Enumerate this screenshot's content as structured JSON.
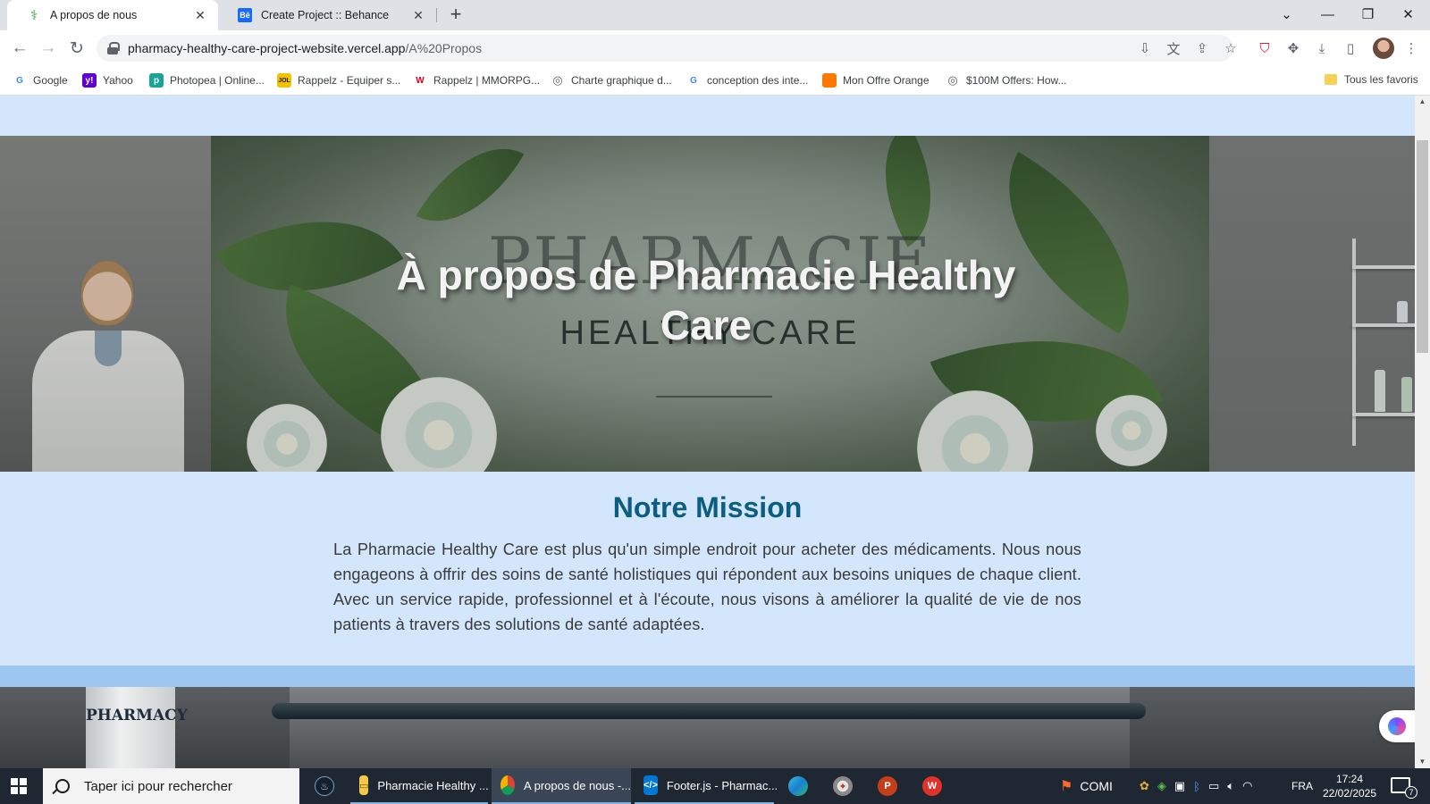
{
  "browser": {
    "tabs": [
      {
        "title": "A propos de nous",
        "active": true,
        "favicon": "caduceus-icon"
      },
      {
        "title": "Create Project :: Behance",
        "active": false,
        "favicon": "behance-icon",
        "favicon_text": "Bē"
      }
    ],
    "new_tab_label": "+",
    "window_controls": {
      "tab_search": "⌄",
      "minimize": "—",
      "restore": "❐",
      "close": "✕"
    },
    "url_host": "pharmacy-healthy-care-project-website.vercel.app",
    "url_path": "/A%20Propos",
    "bookmarks": [
      {
        "label": "Google",
        "icon": "google-icon",
        "icon_text": "G",
        "color": "#4285f4"
      },
      {
        "label": "Yahoo",
        "icon": "yahoo-icon",
        "icon_text": "y!",
        "color": "#6001d2"
      },
      {
        "label": "Photopea | Online...",
        "icon": "photopea-icon",
        "icon_text": "p",
        "color": "#18a497"
      },
      {
        "label": "Rappelz - Equiper s...",
        "icon": "rappelz-icon",
        "icon_text": "JOL",
        "color": "#1a1a1a"
      },
      {
        "label": "Rappelz | MMORPG...",
        "icon": "webzen-icon",
        "icon_text": "W",
        "color": "#d9001b"
      },
      {
        "label": "Charte graphique d...",
        "icon": "globe-icon",
        "icon_text": "◎",
        "color": "#5f6368"
      },
      {
        "label": "conception des inte...",
        "icon": "google-icon",
        "icon_text": "G",
        "color": "#4285f4"
      },
      {
        "label": "Mon Offre Orange",
        "icon": "orange-icon",
        "icon_text": "",
        "color": "#ff7900"
      },
      {
        "label": "$100M Offers: How...",
        "icon": "globe-icon",
        "icon_text": "◎",
        "color": "#5f6368"
      }
    ],
    "all_bookmarks_label": "Tous les favoris"
  },
  "hero": {
    "title": "À propos de Pharmacie Healthy Care",
    "background_brand_top": "PHARMACIE",
    "background_brand_bottom": "HEALTHY CARE"
  },
  "mission": {
    "title": "Notre Mission",
    "text": "La Pharmacie Healthy Care est plus qu'un simple endroit pour acheter des médicaments. Nous nous engageons à offrir des soins de santé holistiques qui répondent aux besoins uniques de chaque client. Avec un service rapide, professionnel et à l'écoute, nous visons à améliorer la qualité de vie de nos patients à travers des solutions de santé adaptées."
  },
  "next_section": {
    "jar_label": "PHARMACY"
  },
  "taskbar": {
    "search_placeholder": "Taper ici pour rechercher",
    "tasks": [
      {
        "label": "",
        "icon": "steam-icon"
      },
      {
        "label": "Pharmacie Healthy ...",
        "icon": "file-explorer-icon"
      },
      {
        "label": "A propos de nous -...",
        "icon": "chrome-icon"
      },
      {
        "label": "Footer.js - Pharmac...",
        "icon": "vscode-icon"
      },
      {
        "label": "",
        "icon": "edge-icon"
      },
      {
        "label": "",
        "icon": "app-icon"
      },
      {
        "label": "",
        "icon": "powerpoint-icon"
      },
      {
        "label": "",
        "icon": "wps-icon"
      }
    ],
    "tray_app_label": "COMI",
    "language": "FRA",
    "time": "17:24",
    "date": "22/02/2025",
    "notification_count": "7"
  },
  "colors": {
    "page_bg": "#d4e6fb",
    "mission_title": "#0b5e82",
    "band": "#9dc6f1",
    "taskbar": "#1f2733"
  }
}
